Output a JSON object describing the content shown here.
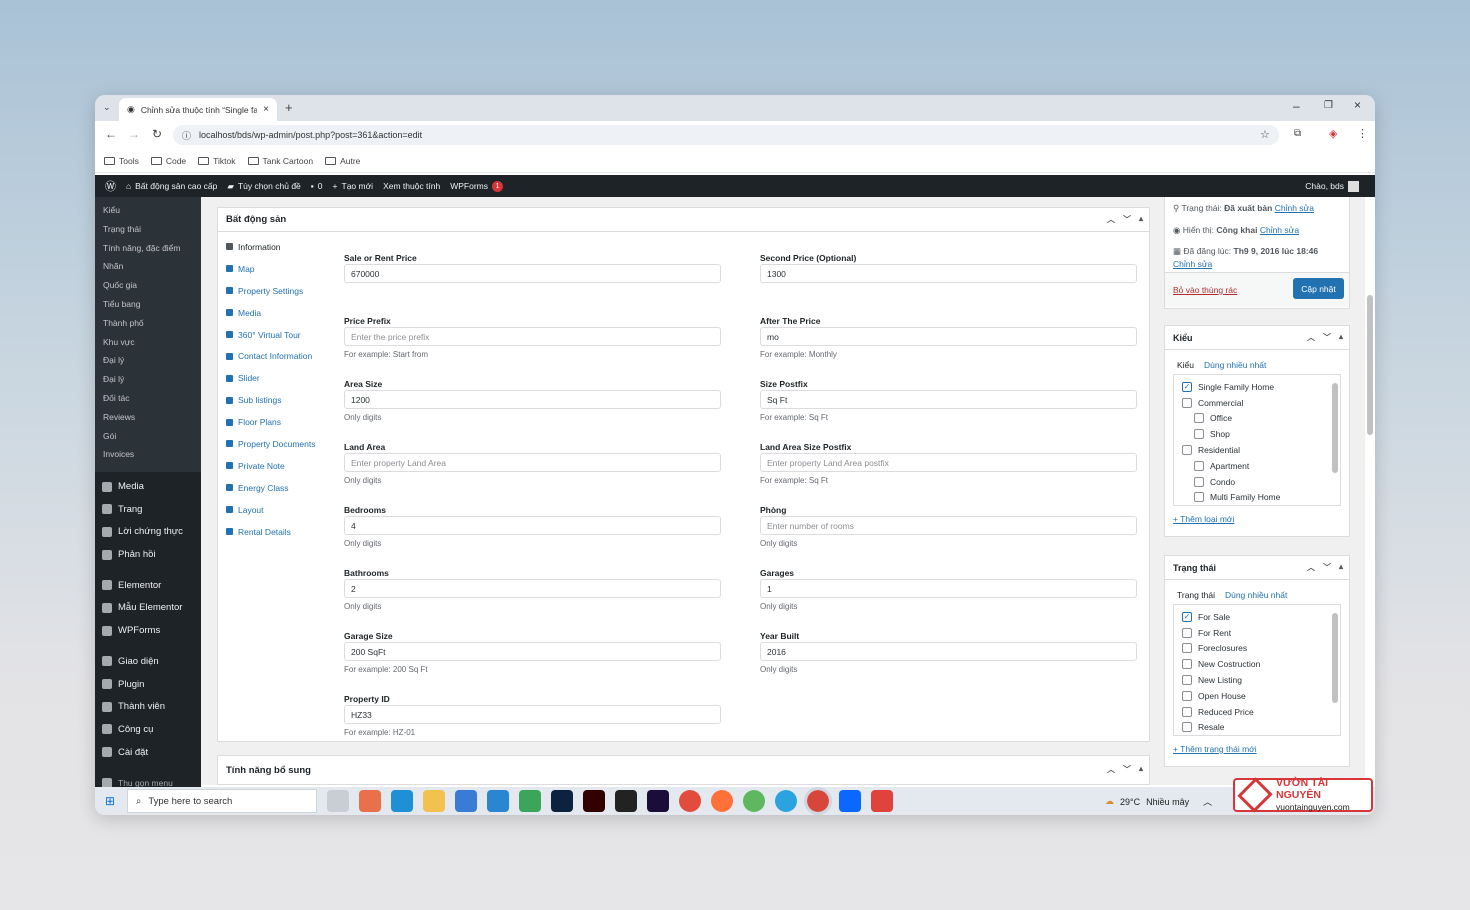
{
  "browser": {
    "tab_title": "Chỉnh sửa thuộc tính “Single fa",
    "url": "localhost/bds/wp-admin/post.php?post=361&action=edit",
    "bookmarks": [
      "Tools",
      "Code",
      "Tiktok",
      "Tank Cartoon",
      "Autre"
    ]
  },
  "adminbar": {
    "site": "Bất động sản cao cấp",
    "customize": "Tùy chọn chủ đề",
    "comments": "0",
    "new": "Tạo mới",
    "view": "Xem thuộc tính",
    "wpforms": "WPForms",
    "wpforms_badge": "1",
    "greeting": "Chào, bds"
  },
  "sidebar": {
    "submenu": [
      "Kiểu",
      "Trạng thái",
      "Tính năng, đặc điểm",
      "Nhãn",
      "Quốc gia",
      "Tiểu bang",
      "Thành phố",
      "Khu vực",
      "Đại lý",
      "Đại lý",
      "Đối tác",
      "Reviews",
      "Gói",
      "Invoices"
    ],
    "menu": [
      "Media",
      "Trang",
      "Lời chứng thực",
      "Phản hồi",
      "Elementor",
      "Mẫu Elementor",
      "WPForms",
      "Giao diện",
      "Plugin",
      "Thành viên",
      "Công cụ",
      "Cài đặt",
      "Thu gọn menu"
    ]
  },
  "panel": {
    "title": "Bất động sản",
    "tabs": [
      "Information",
      "Map",
      "Property Settings",
      "Media",
      "360° Virtual Tour",
      "Contact Information",
      "Slider",
      "Sub listings",
      "Floor Plans",
      "Property Documents",
      "Private Note",
      "Energy Class",
      "Layout",
      "Rental Details"
    ],
    "left": [
      {
        "label": "Sale or Rent Price",
        "value": "670000",
        "placeholder": "",
        "help": ""
      },
      {
        "label": "Price Prefix",
        "value": "",
        "placeholder": "Enter the price prefix",
        "help": "For example: Start from"
      },
      {
        "label": "Area Size",
        "value": "1200",
        "placeholder": "",
        "help": "Only digits"
      },
      {
        "label": "Land Area",
        "value": "",
        "placeholder": "Enter property Land Area",
        "help": "Only digits"
      },
      {
        "label": "Bedrooms",
        "value": "4",
        "placeholder": "",
        "help": "Only digits"
      },
      {
        "label": "Bathrooms",
        "value": "2",
        "placeholder": "",
        "help": "Only digits"
      },
      {
        "label": "Garage Size",
        "value": "200 SqFt",
        "placeholder": "",
        "help": "For example: 200 Sq Ft"
      },
      {
        "label": "Property ID",
        "value": "HZ33",
        "placeholder": "",
        "help": "For example: HZ-01"
      }
    ],
    "right": [
      {
        "label": "Second Price (Optional)",
        "value": "1300",
        "placeholder": "",
        "help": ""
      },
      {
        "label": "After The Price",
        "value": "mo",
        "placeholder": "",
        "help": "For example: Monthly"
      },
      {
        "label": "Size Postfix",
        "value": "Sq Ft",
        "placeholder": "",
        "help": "For example: Sq Ft"
      },
      {
        "label": "Land Area Size Postfix",
        "value": "",
        "placeholder": "Enter property Land Area postfix",
        "help": "For example: Sq Ft"
      },
      {
        "label": "Phòng",
        "value": "",
        "placeholder": "Enter number of rooms",
        "help": "Only digits"
      },
      {
        "label": "Garages",
        "value": "1",
        "placeholder": "",
        "help": "Only digits"
      },
      {
        "label": "Year Built",
        "value": "2016",
        "placeholder": "",
        "help": "Only digits"
      }
    ]
  },
  "panel2": {
    "title": "Tính năng bổ sung"
  },
  "publish": {
    "status_label": "Trạng thái:",
    "status_value": "Đã xuất bản",
    "visibility_label": "Hiển thị:",
    "visibility_value": "Công khai",
    "date_label": "Đã đăng lúc:",
    "date_value": "Th9 9, 2016 lúc 18:46",
    "edit": "Chỉnh sửa",
    "trash": "Bỏ vào thùng rác",
    "update": "Cập nhật"
  },
  "types_box": {
    "title": "Kiểu",
    "tab1": "Kiểu",
    "tab2": "Dùng nhiều nhất",
    "items": [
      {
        "label": "Single Family Home",
        "checked": true,
        "indent": false
      },
      {
        "label": "Commercial",
        "checked": false,
        "indent": false
      },
      {
        "label": "Office",
        "checked": false,
        "indent": true
      },
      {
        "label": "Shop",
        "checked": false,
        "indent": true
      },
      {
        "label": "Residential",
        "checked": false,
        "indent": false
      },
      {
        "label": "Apartment",
        "checked": false,
        "indent": true
      },
      {
        "label": "Condo",
        "checked": false,
        "indent": true
      },
      {
        "label": "Multi Family Home",
        "checked": false,
        "indent": true
      }
    ],
    "add": "+ Thêm loại mới"
  },
  "status_box": {
    "title": "Trạng thái",
    "tab1": "Trạng thái",
    "tab2": "Dùng nhiều nhất",
    "items": [
      {
        "label": "For Sale",
        "checked": true
      },
      {
        "label": "For Rent",
        "checked": false
      },
      {
        "label": "Foreclosures",
        "checked": false
      },
      {
        "label": "New Costruction",
        "checked": false
      },
      {
        "label": "New Listing",
        "checked": false
      },
      {
        "label": "Open House",
        "checked": false
      },
      {
        "label": "Reduced Price",
        "checked": false
      },
      {
        "label": "Resale",
        "checked": false
      }
    ],
    "add": "+ Thêm trạng thái mới"
  },
  "taskbar": {
    "search": "Type here to search",
    "temp": "29°C",
    "weather": "Nhiều mây"
  },
  "watermark": {
    "line1": "VƯỜN TÀI NGUYÊN",
    "line2": "vuontainguyen.com"
  }
}
